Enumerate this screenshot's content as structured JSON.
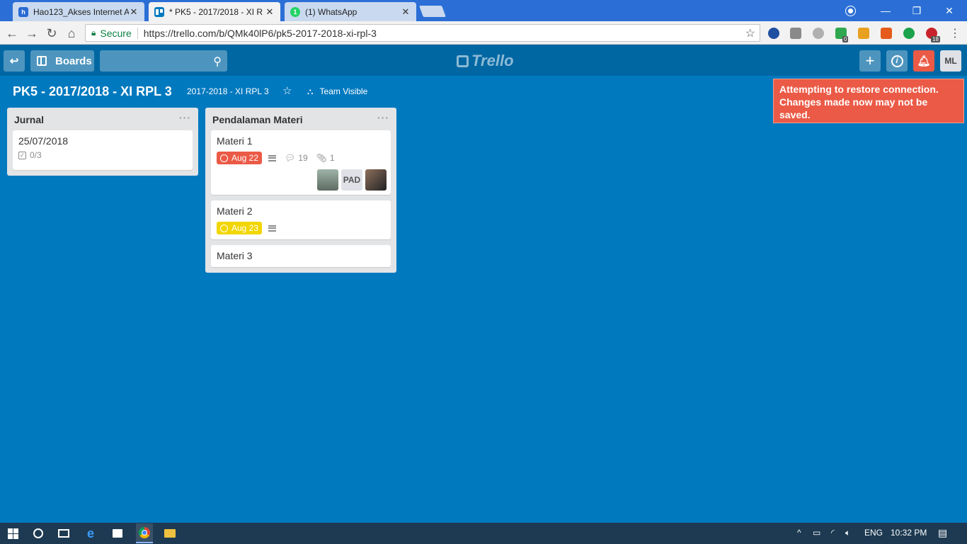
{
  "browser": {
    "tabs": [
      {
        "title": "Hao123_Akses Internet A",
        "favicon_color": "#2a6ad4",
        "favicon_glyph": "h"
      },
      {
        "title": "* PK5 - 2017/2018 - XI R",
        "favicon_color": "#0079bf",
        "favicon_glyph": "T"
      },
      {
        "title": "(1) WhatsApp",
        "favicon_color": "#25d366",
        "favicon_glyph": "1"
      }
    ],
    "secure_label": "Secure",
    "url": "https://trello.com/b/QMk40lP6/pk5-2017-2018-xi-rpl-3"
  },
  "header": {
    "boards_label": "Boards",
    "search_placeholder": "",
    "logo_text": "Trello",
    "avatar_initials": "ML"
  },
  "board": {
    "title": "PK5 - 2017/2018 - XI RPL 3",
    "team": "2017-2018 - XI RPL 3",
    "visibility": "Team Visible"
  },
  "alert": {
    "text": "Attempting to restore connection. Changes made now may not be saved."
  },
  "lists": [
    {
      "title": "Jurnal",
      "cards": [
        {
          "title": "25/07/2018",
          "checklist": "0/3"
        }
      ]
    },
    {
      "title": "Pendalaman Materi",
      "cards": [
        {
          "title": "Materi 1",
          "due": "Aug 22",
          "comments": "19",
          "attachments": "1",
          "member_initials": "PAD"
        },
        {
          "title": "Materi 2",
          "due": "Aug 23"
        },
        {
          "title": "Materi 3"
        }
      ]
    }
  ],
  "taskbar": {
    "language": "ENG",
    "time": "10:32 PM"
  }
}
